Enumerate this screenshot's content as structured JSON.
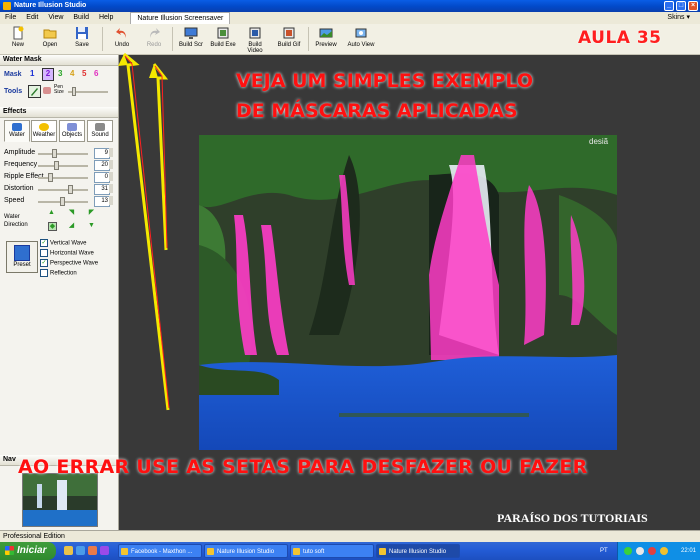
{
  "window": {
    "title": "Nature Illusion Studio"
  },
  "menu": {
    "items": [
      "File",
      "Edit",
      "View",
      "Build",
      "Help"
    ],
    "tab": "Nature Illusion Screensaver",
    "skins": "Skins ▾"
  },
  "toolbar": {
    "buttons": [
      "New",
      "Open",
      "Save",
      "Undo",
      "Redo",
      "Build Scr",
      "Build Exe",
      "Build Video",
      "Build Gif",
      "Preview",
      "Auto View"
    ]
  },
  "overlay": {
    "aula": "AULA 35",
    "caption_line1": "VEJA UM SIMPLES EXEMPLO",
    "caption_line2": "DE MÁSCARAS APLICADAS",
    "caption_bottom": "AO ERRAR USE AS SETAS PARA DESFAZER OU FAZER",
    "brand": "PARAÍSO DOS TUTORIAIS",
    "watermark": "desiã"
  },
  "water_mask": {
    "title": "Water Mask",
    "mask_label": "Mask",
    "mask_numbers": [
      "1",
      "2",
      "3",
      "4",
      "5",
      "6"
    ],
    "tools_label": "Tools",
    "pen_size_label": "Pen Size"
  },
  "effects": {
    "title": "Effects",
    "tabs": [
      "Water",
      "Weather",
      "Objects",
      "Sound"
    ],
    "sliders": [
      {
        "label": "Amplitude",
        "value": "9"
      },
      {
        "label": "Frequency",
        "value": "20"
      },
      {
        "label": "Ripple Effect",
        "value": "0"
      },
      {
        "label": "Distortion",
        "value": "31"
      },
      {
        "label": "Speed",
        "value": "13"
      }
    ],
    "water_direction_label": "Water Direction",
    "preset_label": "Preset",
    "checkboxes": [
      {
        "label": "Vertical Wave",
        "checked": true
      },
      {
        "label": "Horizontal Wave",
        "checked": false
      },
      {
        "label": "Perspective Wave",
        "checked": true
      },
      {
        "label": "Reflection",
        "checked": false
      }
    ]
  },
  "navigator": {
    "title": "Nav"
  },
  "status": {
    "text": "Professional Edition"
  },
  "taskbar": {
    "start": "Iniciar",
    "tasks": [
      "Facebook - Maxthon ...",
      "Nature Illusion Studio",
      "tuto soft",
      "Nature Illusion Studio"
    ],
    "language": "PT",
    "clock": "22:01"
  },
  "colors": {
    "caption": "#ff1010",
    "titlebar": "#0a5de6",
    "mask_pink": "#ff3cc8"
  }
}
